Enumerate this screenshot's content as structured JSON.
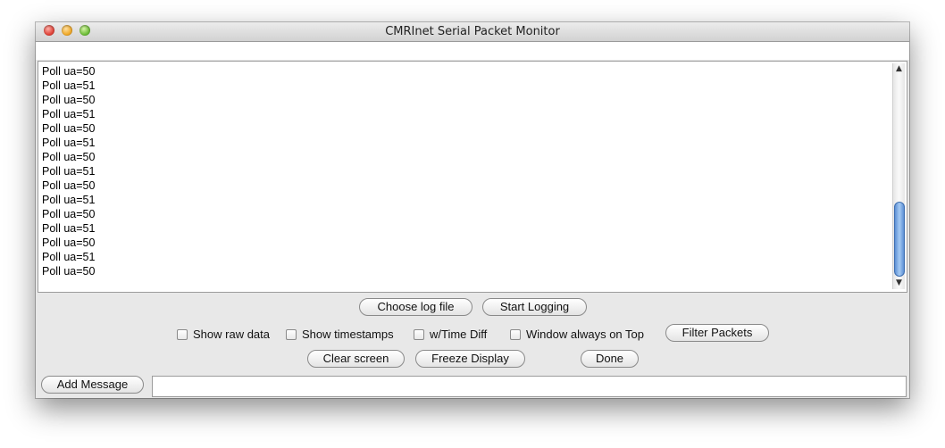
{
  "window": {
    "title": "CMRInet Serial Packet Monitor"
  },
  "log": {
    "lines": [
      "Poll ua=50",
      "Poll ua=51",
      "Poll ua=50",
      "Poll ua=51",
      "Poll ua=50",
      "Poll ua=51",
      "Poll ua=50",
      "Poll ua=51",
      "Poll ua=50",
      "Poll ua=51",
      "Poll ua=50",
      "Poll ua=51",
      "Poll ua=50",
      "Poll ua=51",
      "Poll ua=50"
    ]
  },
  "buttons": {
    "choose_log_file": "Choose log file",
    "start_logging": "Start Logging",
    "filter_packets": "Filter Packets",
    "clear_screen": "Clear screen",
    "freeze_display": "Freeze Display",
    "done": "Done",
    "add_message": "Add Message"
  },
  "checkboxes": {
    "show_raw_data": {
      "label": "Show raw data",
      "checked": false
    },
    "show_timestamps": {
      "label": "Show timestamps",
      "checked": false
    },
    "time_diff": {
      "label": "w/Time Diff",
      "checked": false
    },
    "always_on_top": {
      "label": "Window always on Top",
      "checked": false
    }
  },
  "message_field": {
    "value": ""
  }
}
